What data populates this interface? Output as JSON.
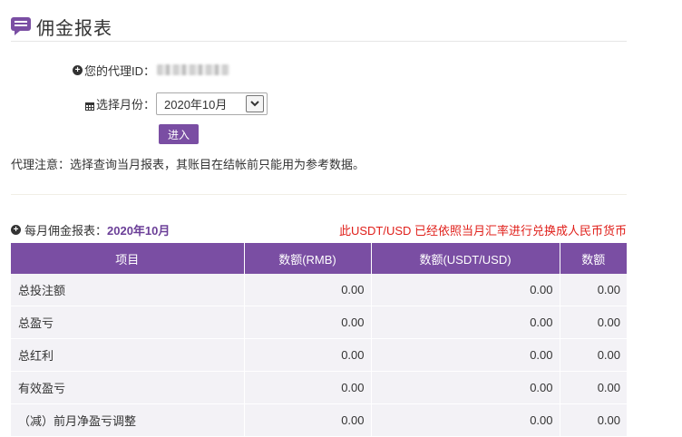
{
  "header": {
    "title": "佣金报表",
    "icon": "chat-bubble-icon",
    "accent": "#7a4ea3"
  },
  "form": {
    "agent_label": "您的代理ID：",
    "agent_id_masked": "",
    "month_label": "选择月份：",
    "month_value": "2020年10月",
    "enter_button": "进入"
  },
  "notice": "代理注意：选择查询当月报表，其账目在结帐前只能用为参考数据。",
  "report": {
    "label": "每月佣金报表：",
    "month": "2020年10月",
    "rate_note": "此USDT/USD 已经依照当月汇率进行兑换成人民币货币",
    "rate_note_color": "#e0201b",
    "headers": [
      "项目",
      "数额(RMB)",
      "数额(USDT/USD)",
      "数额"
    ],
    "rows": [
      {
        "item": "总投注额",
        "rmb": "0.00",
        "usdt": "0.00",
        "amount": "0.00"
      },
      {
        "item": "总盈亏",
        "rmb": "0.00",
        "usdt": "0.00",
        "amount": "0.00"
      },
      {
        "item": "总红利",
        "rmb": "0.00",
        "usdt": "0.00",
        "amount": "0.00"
      },
      {
        "item": "有效盈亏",
        "rmb": "0.00",
        "usdt": "0.00",
        "amount": "0.00"
      },
      {
        "item": "（减）前月净盈亏调整",
        "rmb": "0.00",
        "usdt": "0.00",
        "amount": "0.00"
      }
    ]
  }
}
